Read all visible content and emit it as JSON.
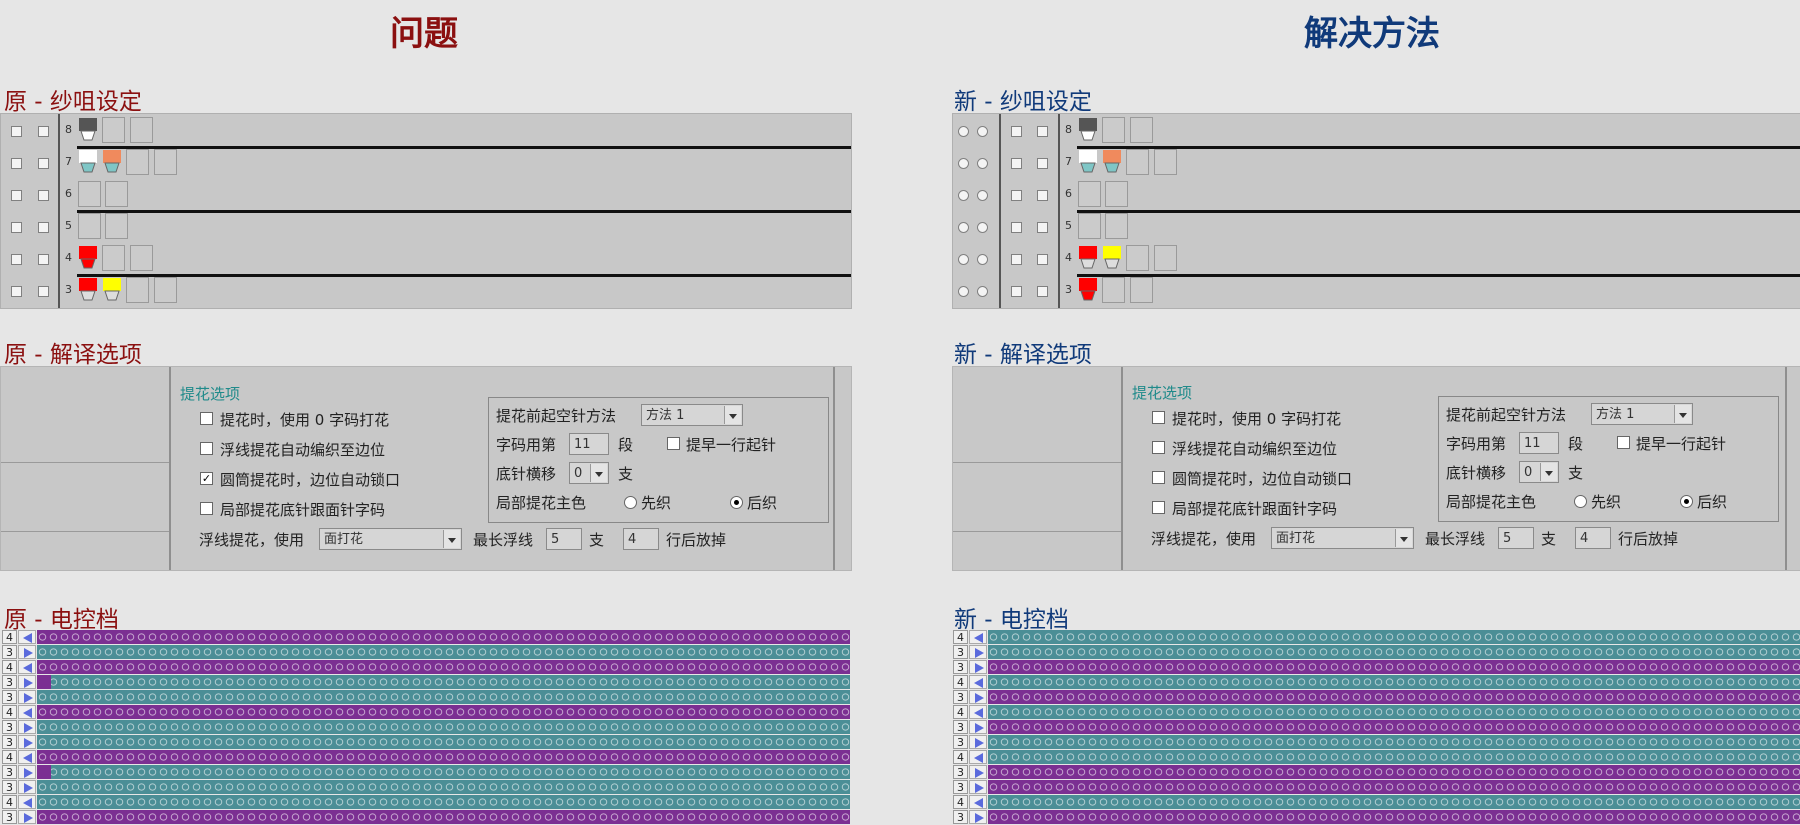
{
  "titles": {
    "problem": "问题",
    "solution": "解决方法"
  },
  "sections": {
    "left_yarn": "原 - 纱咀设定",
    "right_yarn": "新 - 纱咀设定",
    "left_options": "原 - 解译选项",
    "right_options": "新 - 解译选项",
    "left_knit": "原 - 电控档",
    "right_knit": "新 - 电控档"
  },
  "yarn_rows": [
    "8",
    "7",
    "6",
    "5",
    "4",
    "3"
  ],
  "colors": {
    "title_red": "#8b1010",
    "title_blue": "#103a7a",
    "carrier_red": "#ff0000",
    "carrier_yellow": "#ffff00",
    "carrier_orange": "#f08a5d",
    "carrier_dark": "#555555",
    "carrier_white": "#ffffff",
    "knit_purple": "#7b2f92",
    "knit_teal": "#4b8e96",
    "arrow_blue": "#5a6adc"
  },
  "options": {
    "group_title": "提花选项",
    "opt1": "提花时，使用 0 字码打花",
    "opt2": "浮线提花自动编织至边位",
    "opt3": "圆筒提花时，边位自动锁口",
    "opt4": "局部提花底针跟面针字码",
    "float_label": "浮线提花，使用",
    "float_value": "面打花",
    "max_float_label": "最长浮线",
    "max_float_value": "5",
    "unit_zhi": "支",
    "rows_value": "4",
    "rows_label": "行后放掉",
    "empty_needle_label": "提花前起空针方法",
    "empty_needle_value": "方法 1",
    "code_label": "字码用第",
    "code_value": "11",
    "code_unit": "段",
    "early_label": "提早一行起针",
    "shift_label": "底针横移",
    "shift_value": "0",
    "shift_unit": "支",
    "main_color_label": "局部提花主色",
    "main_opt_a": "先织",
    "main_opt_b": "后织",
    "left_opt3_checked": true,
    "right_opt3_checked": false
  },
  "knit_left": [
    "4",
    "3",
    "4",
    "3",
    "3",
    "4",
    "3",
    "3",
    "4",
    "3",
    "3",
    "4",
    "3"
  ],
  "knit_right": [
    "4",
    "3",
    "3",
    "4",
    "3",
    "4",
    "3",
    "3",
    "4",
    "3",
    "3",
    "4",
    "3"
  ]
}
